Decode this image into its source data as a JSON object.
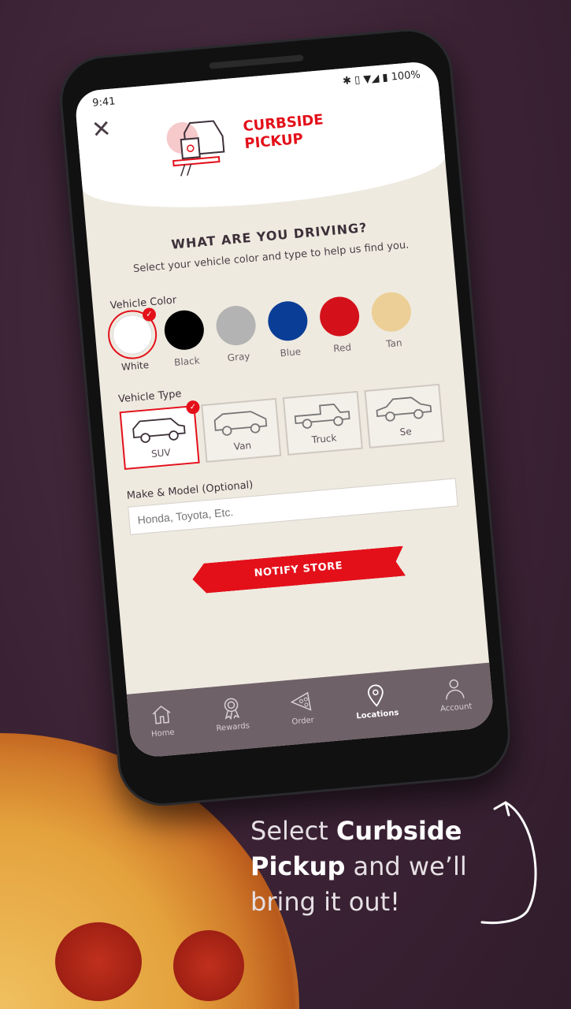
{
  "status": {
    "time": "9:41",
    "battery": "100%"
  },
  "header": {
    "title_line1": "CURBSIDE",
    "title_line2": "PICKUP",
    "close_icon": "close-icon"
  },
  "main": {
    "heading": "WHAT ARE YOU DRIVING?",
    "subtitle": "Select your vehicle color and type to help us find you.",
    "color_label": "Vehicle Color",
    "colors": [
      {
        "name": "White",
        "hex": "#ffffff",
        "selected": true
      },
      {
        "name": "Black",
        "hex": "#000000"
      },
      {
        "name": "Gray",
        "hex": "#b3b3b3"
      },
      {
        "name": "Blue",
        "hex": "#0a3d96"
      },
      {
        "name": "Red",
        "hex": "#d4101a"
      },
      {
        "name": "Tan",
        "hex": "#eccf96"
      }
    ],
    "type_label": "Vehicle Type",
    "types": [
      {
        "name": "SUV",
        "selected": true
      },
      {
        "name": "Van"
      },
      {
        "name": "Truck"
      },
      {
        "name": "Se"
      }
    ],
    "make_label": "Make & Model (Optional)",
    "make_placeholder": "Honda, Toyota, Etc.",
    "notify_button": "NOTIFY STORE"
  },
  "nav": [
    {
      "label": "Home",
      "icon": "home-icon"
    },
    {
      "label": "Rewards",
      "icon": "ribbon-icon"
    },
    {
      "label": "Order",
      "icon": "pizza-slice-icon"
    },
    {
      "label": "Locations",
      "icon": "location-pin-icon",
      "active": true
    },
    {
      "label": "Account",
      "icon": "person-icon"
    }
  ],
  "tagline": {
    "pre": "Select ",
    "bold1": "Curbside",
    "bold2": "Pickup",
    "post": " and we’ll",
    "line3": "bring it out!"
  },
  "accent": "#e3101a"
}
